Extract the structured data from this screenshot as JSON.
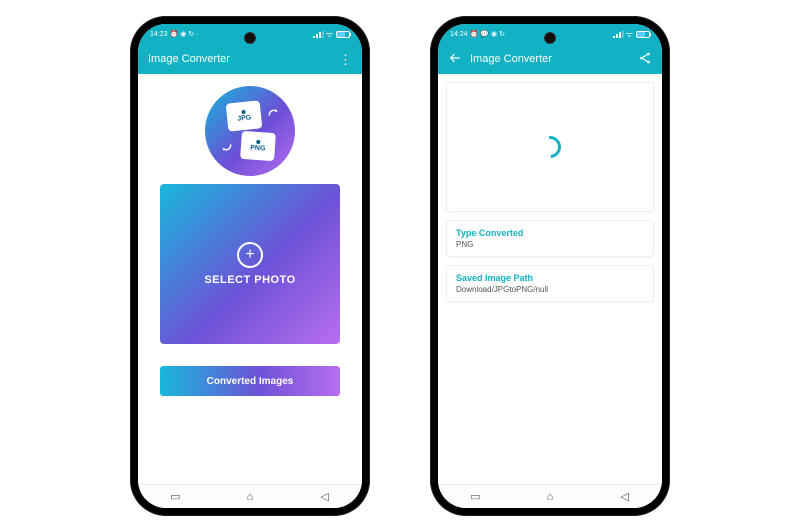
{
  "phone1": {
    "status": {
      "time": "14:23"
    },
    "appbar": {
      "title": "Image Converter"
    },
    "logo": {
      "label1": "JPG",
      "label2": "PNG"
    },
    "select": {
      "label": "SELECT PHOTO"
    },
    "converted_btn": "Converted Images"
  },
  "phone2": {
    "status": {
      "time": "14:24"
    },
    "appbar": {
      "title": "Image Converter"
    },
    "type_card": {
      "title": "Type Converted",
      "value": "PNG"
    },
    "path_card": {
      "title": "Saved Image Path",
      "value": "Download/JPGtoPNG/null"
    }
  }
}
